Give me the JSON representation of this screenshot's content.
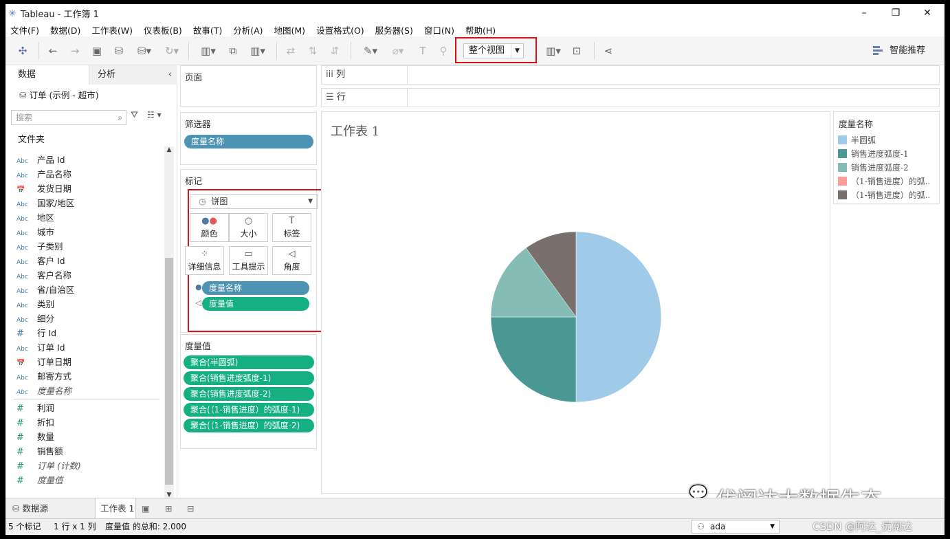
{
  "window": {
    "title": "Tableau - 工作簿 1",
    "min": "–",
    "max": "❐",
    "close": "✕"
  },
  "menu": [
    "文件(F)",
    "数据(D)",
    "工作表(W)",
    "仪表板(B)",
    "故事(T)",
    "分析(A)",
    "地图(M)",
    "设置格式(O)",
    "服务器(S)",
    "窗口(N)",
    "帮助(H)"
  ],
  "toolbar": {
    "fit": "整个视图",
    "smart": "智能推荐"
  },
  "datapane": {
    "tab_data": "数据",
    "tab_analysis": "分析",
    "datasource": "订单 (示例 - 超市)",
    "search_placeholder": "搜索",
    "folder": "文件夹",
    "dims": [
      {
        "t": "Abc",
        "n": "产品 Id"
      },
      {
        "t": "Abc",
        "n": "产品名称"
      },
      {
        "t": "date",
        "n": "发货日期"
      },
      {
        "t": "Abc",
        "n": "国家/地区"
      },
      {
        "t": "Abc",
        "n": "地区"
      },
      {
        "t": "Abc",
        "n": "城市"
      },
      {
        "t": "Abc",
        "n": "子类别"
      },
      {
        "t": "Abc",
        "n": "客户 Id"
      },
      {
        "t": "Abc",
        "n": "客户名称"
      },
      {
        "t": "Abc",
        "n": "省/自治区"
      },
      {
        "t": "Abc",
        "n": "类别"
      },
      {
        "t": "Abc",
        "n": "细分"
      },
      {
        "t": "#",
        "n": "行 Id"
      },
      {
        "t": "Abc",
        "n": "订单 Id"
      },
      {
        "t": "date",
        "n": "订单日期"
      },
      {
        "t": "Abc",
        "n": "邮寄方式"
      },
      {
        "t": "Abc",
        "n": "度量名称",
        "italic": true
      }
    ],
    "measures": [
      {
        "n": "利润"
      },
      {
        "n": "折扣"
      },
      {
        "n": "数量"
      },
      {
        "n": "销售额"
      },
      {
        "n": "订单 (计数)",
        "italic": true
      },
      {
        "n": "度量值",
        "italic": true
      }
    ]
  },
  "pages": {
    "title": "页面"
  },
  "filters": {
    "title": "筛选器",
    "pill": "度量名称"
  },
  "marks": {
    "title": "标记",
    "type": "饼图",
    "buttons": [
      "颜色",
      "大小",
      "标签",
      "详细信息",
      "工具提示",
      "角度"
    ],
    "pill_color": "度量名称",
    "pill_angle": "度量值"
  },
  "measure_values": {
    "title": "度量值",
    "pills": [
      "聚合(半圆弧)",
      "聚合(销售进度弧度-1)",
      "聚合(销售进度弧度-2)",
      "聚合(（1-销售进度）的弧度-1)",
      "聚合(（1-销售进度）的弧度-2)"
    ]
  },
  "shelves": {
    "columns": "列",
    "rows": "行"
  },
  "sheet": {
    "title": "工作表 1"
  },
  "legend": {
    "title": "度量名称",
    "items": [
      {
        "name": "半圆弧",
        "color": "#a0cbe8"
      },
      {
        "name": "销售进度弧度-1",
        "color": "#499894"
      },
      {
        "name": "销售进度弧度-2",
        "color": "#86bcb6"
      },
      {
        "name": "（1-销售进度）的弧..",
        "color": "#ff9d9a"
      },
      {
        "name": "（1-销售进度）的弧..",
        "color": "#79706e"
      }
    ]
  },
  "chart_data": {
    "type": "pie",
    "slices": [
      {
        "name": "半圆弧",
        "value": 1.0,
        "color": "#a0cbe8"
      },
      {
        "name": "销售进度弧度-1",
        "value": 0.5,
        "color": "#499894"
      },
      {
        "name": "销售进度弧度-2",
        "value": 0.3,
        "color": "#86bcb6"
      },
      {
        "name": "（1-销售进度）的弧度-2",
        "value": 0.2,
        "color": "#79706e"
      }
    ]
  },
  "watermark": "优阅达大数据生态",
  "bottom_tabs": {
    "datasource": "数据源",
    "sheet": "工作表 1"
  },
  "status": {
    "marks": "5 个标记",
    "rowscols": "1 行 x 1 列",
    "sum": "度量值 的总和: 2.000",
    "user": "ada",
    "csdn": "CSDN @阿达_优阅达"
  }
}
